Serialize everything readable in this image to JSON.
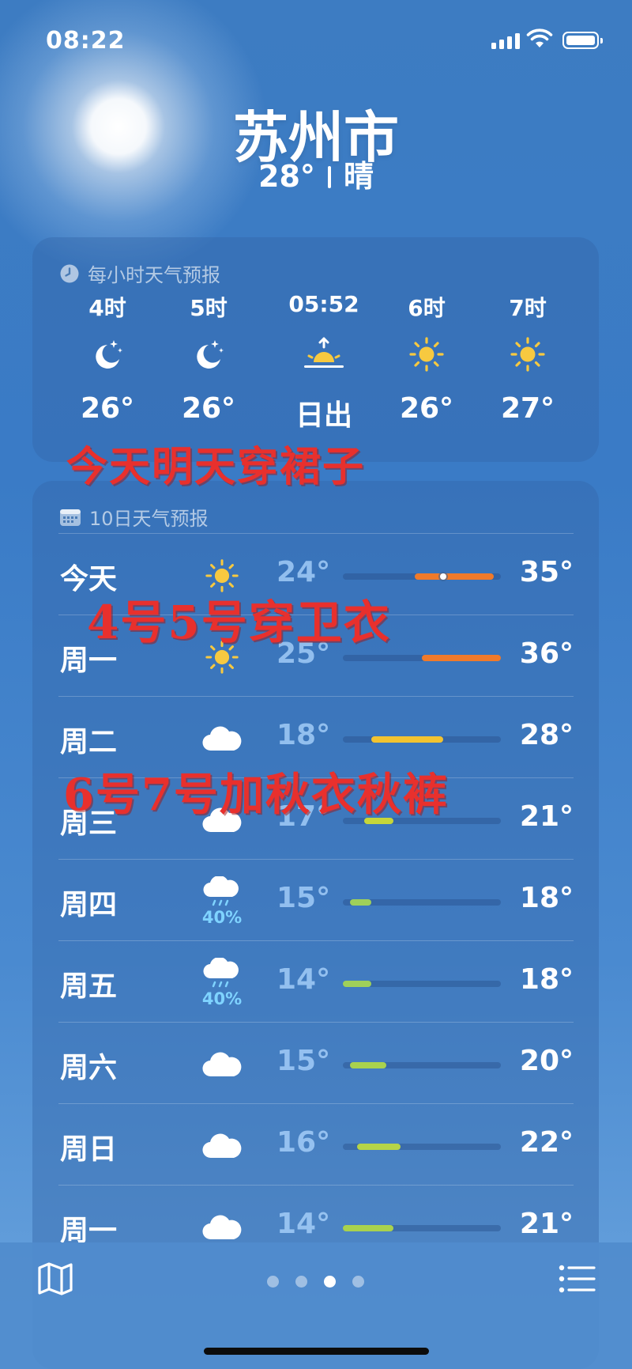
{
  "status": {
    "time": "08:22"
  },
  "header": {
    "city": "苏州市",
    "temperature": "28°",
    "condition": "晴"
  },
  "hourly": {
    "title": "每小时天气预报",
    "items": [
      {
        "time": "4时",
        "icon": "moon-stars-icon",
        "temp": "26°"
      },
      {
        "time": "5时",
        "icon": "moon-stars-icon",
        "temp": "26°"
      },
      {
        "time": "05:52",
        "icon": "sunrise-icon",
        "temp": "日出"
      },
      {
        "time": "6时",
        "icon": "sun-icon",
        "temp": "26°"
      },
      {
        "time": "7时",
        "icon": "sun-icon",
        "temp": "27°"
      }
    ]
  },
  "daily": {
    "title": "10日天气预报",
    "range_min": 14,
    "range_max": 36,
    "days": [
      {
        "day": "今天",
        "icon": "sun-icon",
        "low": "24°",
        "high": "35°",
        "low_val": 24,
        "high_val": 35,
        "color": "#f07a2a",
        "current_val": 28
      },
      {
        "day": "周一",
        "icon": "sun-icon",
        "low": "25°",
        "high": "36°",
        "low_val": 25,
        "high_val": 36,
        "color": "#f07a2a"
      },
      {
        "day": "周二",
        "icon": "cloud-icon",
        "low": "18°",
        "high": "28°",
        "low_val": 18,
        "high_val": 28,
        "color": "#f2c330"
      },
      {
        "day": "周三",
        "icon": "cloud-icon",
        "low": "17°",
        "high": "21°",
        "low_val": 17,
        "high_val": 21,
        "color": "#c6d63a"
      },
      {
        "day": "周四",
        "icon": "cloud-rain-icon",
        "precip": "40%",
        "low": "15°",
        "high": "18°",
        "low_val": 15,
        "high_val": 18,
        "color": "#9fd05a"
      },
      {
        "day": "周五",
        "icon": "cloud-rain-icon",
        "precip": "40%",
        "low": "14°",
        "high": "18°",
        "low_val": 14,
        "high_val": 18,
        "color": "#9fd05a"
      },
      {
        "day": "周六",
        "icon": "cloud-icon",
        "low": "15°",
        "high": "20°",
        "low_val": 15,
        "high_val": 20,
        "color": "#a9d24e"
      },
      {
        "day": "周日",
        "icon": "cloud-icon",
        "low": "16°",
        "high": "22°",
        "low_val": 16,
        "high_val": 22,
        "color": "#b6d447"
      },
      {
        "day": "周一",
        "icon": "cloud-icon",
        "low": "14°",
        "high": "21°",
        "low_val": 14,
        "high_val": 21,
        "color": "#a9d24e"
      }
    ]
  },
  "overlay_texts": [
    "今天明天穿裙子",
    "4号5号穿卫衣",
    "6号7号加秋衣秋裤"
  ],
  "pager": {
    "count": 4,
    "active": 2
  }
}
